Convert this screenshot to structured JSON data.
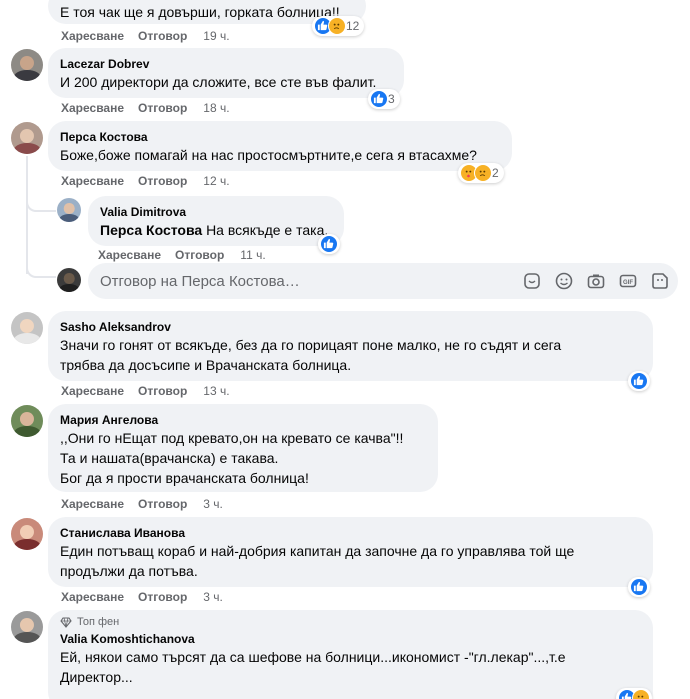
{
  "colors": {
    "like_blue": "#1877f2",
    "bubble_bg": "#f0f2f5",
    "meta_gray": "#65676b"
  },
  "actions": {
    "like": "Харесване",
    "reply": "Отговор"
  },
  "comments": [
    {
      "text": "Е тоя чак ще я довърши, горката болница!!",
      "time": "19 ч.",
      "reaction_count": "12",
      "reactions": [
        "like-icon",
        "sad-icon"
      ]
    },
    {
      "author": "Lacezar Dobrev",
      "text": "И 200 директори да сложите, все сте във фалит.",
      "time": "18 ч.",
      "reaction_count": "3",
      "reactions": [
        "like-icon"
      ]
    },
    {
      "author": "Перса Костова",
      "text": "Боже,боже помагай на нас простосмъртните,е сега я втасахме?",
      "time": "12 ч.",
      "reaction_count": "2",
      "reactions": [
        "care-icon",
        "sad-icon"
      ]
    },
    {
      "author": "Sasho Aleksandrov",
      "text_lines": [
        "Значи го гонят от всякъде, без да го порицаят поне малко, не го съдят и сега",
        "трябва да досъсипе и Врачанската болница."
      ],
      "time": "13 ч.",
      "reactions": [
        "like-icon"
      ]
    },
    {
      "author": "Мария Ангелова",
      "text_lines": [
        ",,Они го нЕщат под кревато,он на кревато се качва\"!!",
        "Та и нашата(врачанска) е такава.",
        "Бог да я прости врачанската болница!"
      ],
      "time": "3 ч."
    },
    {
      "author": "Станислава Иванова",
      "text_lines": [
        "Един потъващ кораб и най-добрия капитан да започне да го управлява той ще",
        "продължи да потъва."
      ],
      "time": "3 ч.",
      "reactions": [
        "like-icon"
      ]
    },
    {
      "badge": "Топ фен",
      "author": "Valia Komoshtichanova",
      "text_lines": [
        "Ей, някои само търсят да са шефове на болници...икономист -\"гл.лекар\"...,т.е",
        "Директор..."
      ]
    }
  ],
  "reply": {
    "author": "Valia Dimitrova",
    "mention": "Перса Костова",
    "text": "На всякъде е така.",
    "time": "11 ч.",
    "reactions": [
      "like-icon"
    ]
  },
  "reply_box": {
    "placeholder": "Отговор на Перса Костова…",
    "icons": [
      "sticker-icon",
      "emoji-icon",
      "camera-icon",
      "gif-icon",
      "avatar-sticker-icon"
    ]
  }
}
